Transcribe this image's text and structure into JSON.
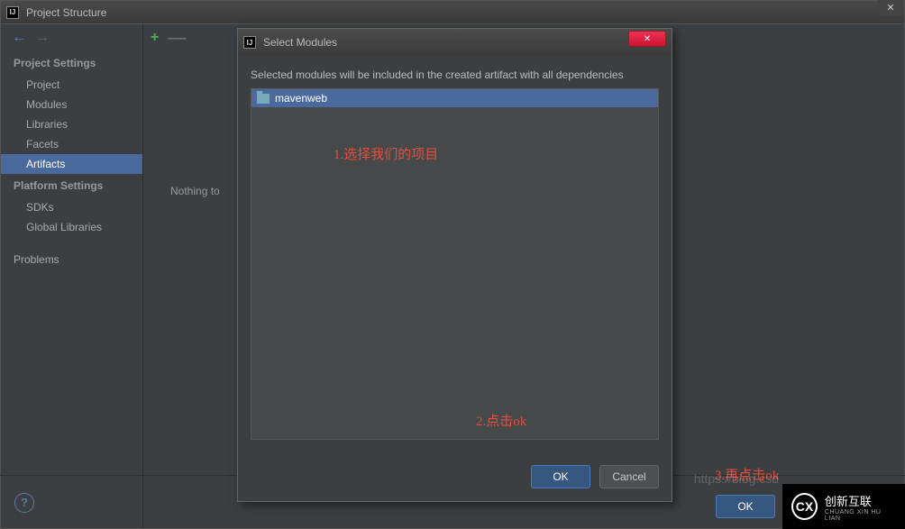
{
  "window": {
    "title": "Project Structure"
  },
  "sidebar": {
    "nav_back": "←",
    "nav_forward": "→",
    "sections": {
      "project_settings": "Project Settings",
      "platform_settings": "Platform Settings"
    },
    "items": {
      "project": "Project",
      "modules": "Modules",
      "libraries": "Libraries",
      "facets": "Facets",
      "artifacts": "Artifacts",
      "sdks": "SDKs",
      "global_libraries": "Global Libraries",
      "problems": "Problems"
    }
  },
  "toolbar": {
    "add": "+",
    "remove": "—"
  },
  "main": {
    "empty_text": "Nothing to"
  },
  "dialog": {
    "title": "Select Modules",
    "description": "Selected modules will be included in the created artifact with all dependencies",
    "module_item": "mavenweb",
    "ok_label": "OK",
    "cancel_label": "Cancel",
    "close_label": "✕"
  },
  "bottom": {
    "help": "?",
    "ok_label": "OK"
  },
  "annotations": {
    "a1": "1.选择我们的项目",
    "a2": "2.点击ok",
    "a3": "3.再点击ok"
  },
  "watermark": {
    "url": "https://blog.csd",
    "brand": "创新互联",
    "brand_sub": "CHUANG XIN HU LIAN",
    "brand_mark": "CX"
  }
}
